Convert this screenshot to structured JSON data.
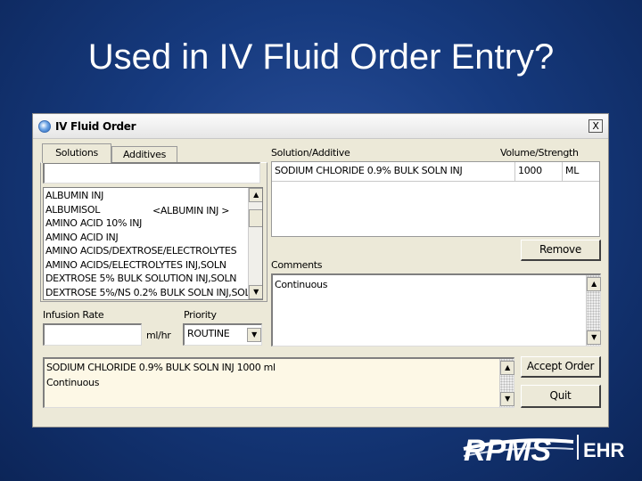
{
  "slide": {
    "title": "Used in IV Fluid Order Entry?"
  },
  "window": {
    "title": "IV Fluid Order",
    "close_glyph": "X"
  },
  "tabs": [
    {
      "label": "Solutions",
      "active": true
    },
    {
      "label": "Additives",
      "active": false
    }
  ],
  "search": {
    "value": "",
    "placeholder": ""
  },
  "solutions_list": [
    "ALBUMIN INJ",
    "ALBUMISOL",
    "AMINO ACID 10% INJ",
    "AMINO ACID INJ",
    "AMINO ACIDS/DEXTROSE/ELECTROLYTES",
    "AMINO ACIDS/ELECTROLYTES INJ,SOLN",
    "DEXTROSE 5% BULK SOLUTION INJ,SOLN",
    "DEXTROSE 5%/NS 0.2% BULK SOLN INJ,SOLN"
  ],
  "list_alias": "<ALBUMIN INJ >",
  "order_table": {
    "header_solution": "Solution/Additive",
    "header_volume": "Volume/Strength",
    "rows": [
      {
        "solution": "SODIUM CHLORIDE 0.9% BULK SOLN INJ",
        "volume": "1000",
        "unit": "ML"
      }
    ]
  },
  "remove_button": "Remove",
  "comments": {
    "label": "Comments",
    "value": "Continuous"
  },
  "infusion_rate": {
    "label": "Infusion Rate",
    "value": "",
    "unit": "ml/hr"
  },
  "priority": {
    "label": "Priority",
    "selected": "ROUTINE"
  },
  "summary": {
    "line1": "SODIUM CHLORIDE 0.9% BULK SOLN INJ  1000 ml",
    "line2": "Continuous"
  },
  "accept_button": "Accept Order",
  "quit_button": "Quit",
  "logo": {
    "text": "RPMS",
    "suffix": "EHR"
  },
  "colors": {
    "slide_background": "#163a7e",
    "window_face": "#ece9d8",
    "summary_background": "#fdf8e6",
    "white": "#ffffff"
  },
  "icons": [
    "app-icon",
    "close-icon",
    "scroll-up-icon",
    "scroll-down-icon",
    "dropdown-arrow-icon"
  ]
}
